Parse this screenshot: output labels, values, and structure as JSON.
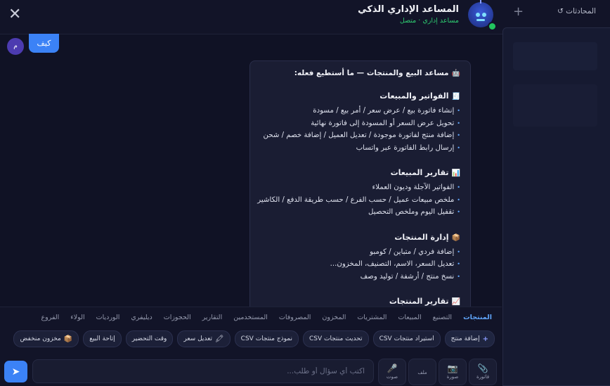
{
  "header": {
    "title": "المساعد الإداري الذكي",
    "subtitle": "مساعد إداري · متصل",
    "history_label": "المحادثات",
    "history_icon": "↺",
    "new_chat_icon": "+",
    "close_icon": "✕"
  },
  "chat": {
    "user_message": "كيف",
    "user_avatar": "م",
    "bot": {
      "heading_icon": "🤖",
      "heading": "مساعد البيع والمنتجات — ما أستطيع فعله:",
      "sections": [
        {
          "icon": "🧾",
          "title": "الفواتير والمبيعات",
          "items": [
            "إنشاء فاتورة بيع / عرض سعر / أمر بيع / مسودة",
            "تحويل عرض السعر أو المسودة إلى فاتورة نهائية",
            "إضافة منتج لفاتورة موجودة / تعديل العميل / إضافة خصم / شحن",
            "إرسال رابط الفاتورة عبر واتساب"
          ]
        },
        {
          "icon": "📊",
          "title": "تقارير المبيعات",
          "items": [
            "الفواتير الآجلة وديون العملاء",
            "ملخص مبيعات عميل / حسب الفرع / حسب طريقة الدفع / الكاشير",
            "تقفيل اليوم وملخص التحصيل"
          ]
        },
        {
          "icon": "📦",
          "title": "إدارة المنتجات",
          "items": [
            "إضافة فردي / متباين / كومبو",
            "تعديل السعر، الاسم، التصنيف، المخزون...",
            "نسخ منتج / أرشفة / توليد وصف"
          ]
        },
        {
          "icon": "📈",
          "title": "تقارير المنتجات",
          "items": []
        }
      ]
    }
  },
  "categories": [
    "المنتجات",
    "التصنيع",
    "المبيعات",
    "المشتريات",
    "المخزون",
    "المصروفات",
    "المستخدمين",
    "التقارير",
    "الحجوزات",
    "ديليفري",
    "الورديات",
    "الولاء",
    "الفروع"
  ],
  "active_category": "المنتجات",
  "quick_actions": [
    {
      "icon": "+",
      "label": "إضافة منتج"
    },
    {
      "icon": "",
      "label": "استيراد منتجات CSV"
    },
    {
      "icon": "",
      "label": "تحديث منتجات CSV"
    },
    {
      "icon": "",
      "label": "نموذج منتجات CSV"
    },
    {
      "icon": "🖍",
      "label": "تعديل سعر"
    },
    {
      "icon": "",
      "label": "وقت التحضير"
    },
    {
      "icon": "",
      "label": "إتاحة البيع"
    },
    {
      "icon": "📦",
      "label": "مخزون منخفض"
    }
  ],
  "composer": {
    "placeholder": "اكتب أي سؤال أو طلب...",
    "send_icon": "➤",
    "tools": [
      {
        "icon": "📎",
        "label": "فاتورة"
      },
      {
        "icon": "📷",
        "label": "صورة"
      },
      {
        "icon": "",
        "label": "ملف"
      },
      {
        "icon": "🎤",
        "label": "صوت"
      }
    ]
  },
  "colors": {
    "accent": "#3b82f6",
    "online": "#2ecc71",
    "background": "#101225"
  }
}
